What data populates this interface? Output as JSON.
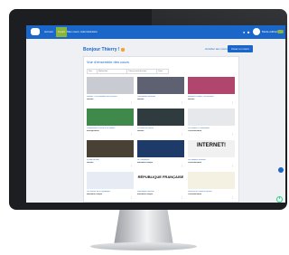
{
  "colors": {
    "primary": "#1a66c9",
    "accent_green": "#8ab43a",
    "bezel": "#1c1e22",
    "power_led": "#38d08a"
  },
  "topbar": {
    "logo_icon": "app-logo-icon",
    "nav": [
      "Accueil",
      "Cours",
      "Mes cours",
      "Administration"
    ],
    "active_index": 1,
    "right_icons": [
      "bell-icon",
      "chat-icon"
    ],
    "user_label": "Mode édition"
  },
  "main": {
    "title": "Bonjour Thierry !",
    "title_icon": "waving-hand-icon",
    "actions": {
      "secondary": "Accéder aux cours",
      "primary": "Créer un cours"
    },
    "panel": {
      "title": "Vue d'ensemble des cours",
      "filters": [
        "Tout",
        "Rechercher",
        "Trier par nom de cours",
        "Carte"
      ]
    },
    "courses": [
      {
        "title": "Histoire - Les institutions de la France",
        "category": "Histoire",
        "thumb_color": "#c8cbd2",
        "overlay": ""
      },
      {
        "title": "L'Assemblée nationale",
        "category": "Histoire",
        "thumb_color": "#5d6171",
        "overlay": ""
      },
      {
        "title": "Éducation civique - les élections",
        "category": "Histoire",
        "thumb_color": "#b0466e",
        "overlay": ""
      },
      {
        "title": "Comprendre la laïcité et les libertés",
        "category": "Enseignement",
        "thumb_color": "#3f8a4a",
        "overlay": ""
      },
      {
        "title": "La justice en France",
        "category": "Histoire",
        "thumb_color": "#2f3b3e",
        "overlay": ""
      },
      {
        "title": "Les médias et l'information",
        "category": "Communication",
        "thumb_color": "#e7e8ec",
        "overlay": ""
      },
      {
        "title": "Le droit de vote",
        "category": "Histoire",
        "thumb_color": "#4a4135",
        "overlay": ""
      },
      {
        "title": "La Constitution",
        "category": "Education civique",
        "thumb_color": "#1e3a68",
        "overlay": ""
      },
      {
        "title": "Les dangers d'Internet",
        "category": "Communication",
        "thumb_color": "#f1f1f1",
        "overlay": "INTERNET!"
      },
      {
        "title": "Les valeurs de la République",
        "category": "Education civique",
        "thumb_color": "#e7ecf4",
        "overlay": ""
      },
      {
        "title": "République française",
        "category": "Education civique",
        "thumb_color": "#ffffff",
        "overlay": "RÉPUBLIQUE FRANÇAISE"
      },
      {
        "title": "Découvrir les réseaux sociaux",
        "category": "Communication",
        "thumb_color": "#f5f1e2",
        "overlay": ""
      }
    ]
  },
  "floating_button": {
    "icon": "help-icon"
  }
}
